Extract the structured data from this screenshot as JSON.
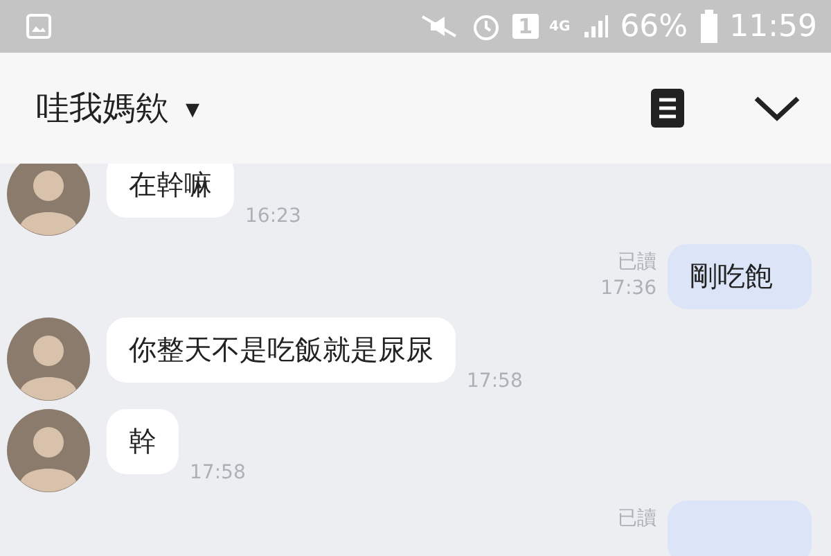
{
  "status_bar": {
    "sim_slot": "1",
    "network": "4G",
    "battery": "66%",
    "time": "11:59"
  },
  "header": {
    "title": "哇我媽欸",
    "dropdown": "▾"
  },
  "messages": [
    {
      "kind": "in",
      "text": "在幹嘛",
      "time": "16:23"
    },
    {
      "kind": "out",
      "text": "剛吃飽",
      "time": "17:36",
      "read": "已讀"
    },
    {
      "kind": "in",
      "text": "你整天不是吃飯就是尿尿",
      "time": "17:58"
    },
    {
      "kind": "in",
      "text": "幹",
      "time": "17:58"
    },
    {
      "kind": "out",
      "read": "已讀"
    }
  ]
}
